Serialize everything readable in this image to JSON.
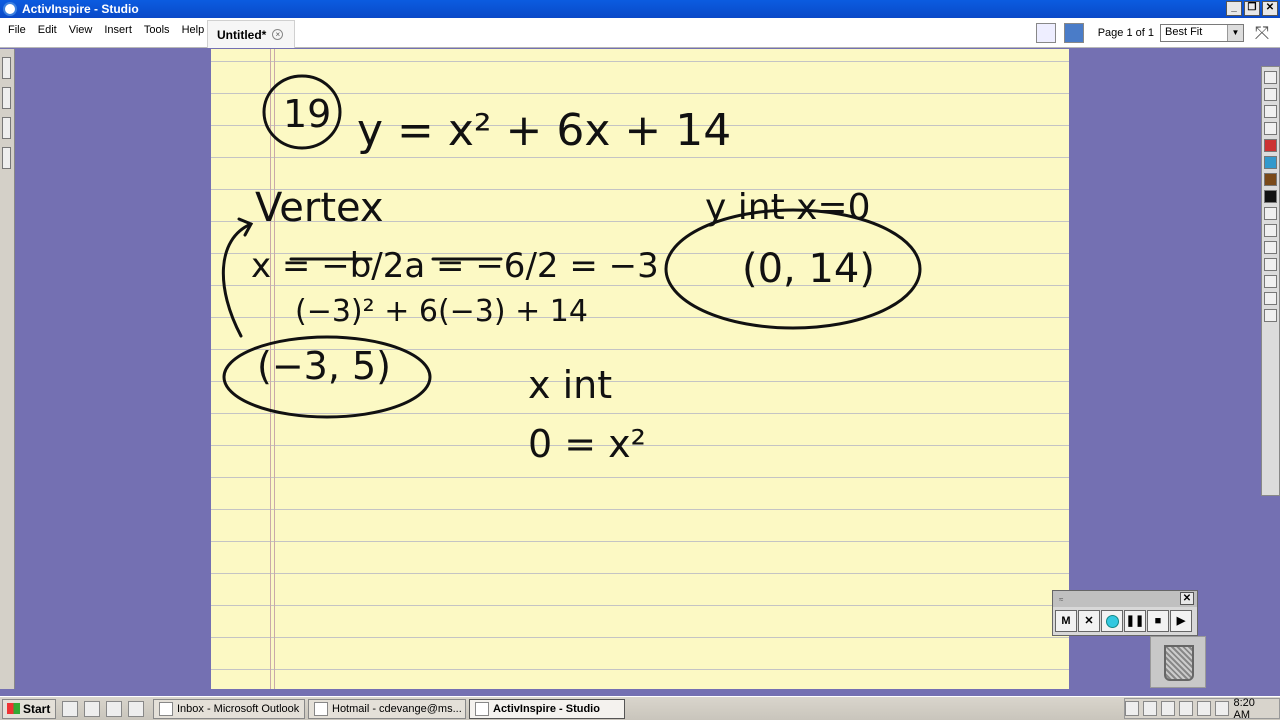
{
  "window": {
    "title": "ActivInspire - Studio"
  },
  "menu": {
    "items": [
      "File",
      "Edit",
      "View",
      "Insert",
      "Tools",
      "Help"
    ]
  },
  "document_tab": {
    "label": "Untitled*"
  },
  "toolbar": {
    "page_info": "Page 1 of 1",
    "zoom_value": "Best Fit"
  },
  "flipchart": {
    "problem_number": "19",
    "equation": "y = x² + 6x + 14",
    "vertex_label": "Vertex",
    "vertex_x_formula": "x = −b/2a = −6/2 = −3",
    "substitution": "(−3)² + 6(−3) + 14",
    "vertex_point": "(−3, 5)",
    "y_int_label": "y int  x=0",
    "y_int_point": "(0, 14)",
    "x_int_label": "x int",
    "x_int_equation": "0 = x²"
  },
  "recorder": {
    "buttons": [
      "M",
      "✕",
      "●",
      "❚❚",
      "■",
      "▶"
    ]
  },
  "taskbar": {
    "start_label": "Start",
    "tasks": [
      {
        "label": "Inbox - Microsoft Outlook",
        "active": false
      },
      {
        "label": "Hotmail - cdevange@ms...",
        "active": false
      },
      {
        "label": "ActivInspire - Studio",
        "active": true
      }
    ],
    "clock": "8:20 AM"
  }
}
